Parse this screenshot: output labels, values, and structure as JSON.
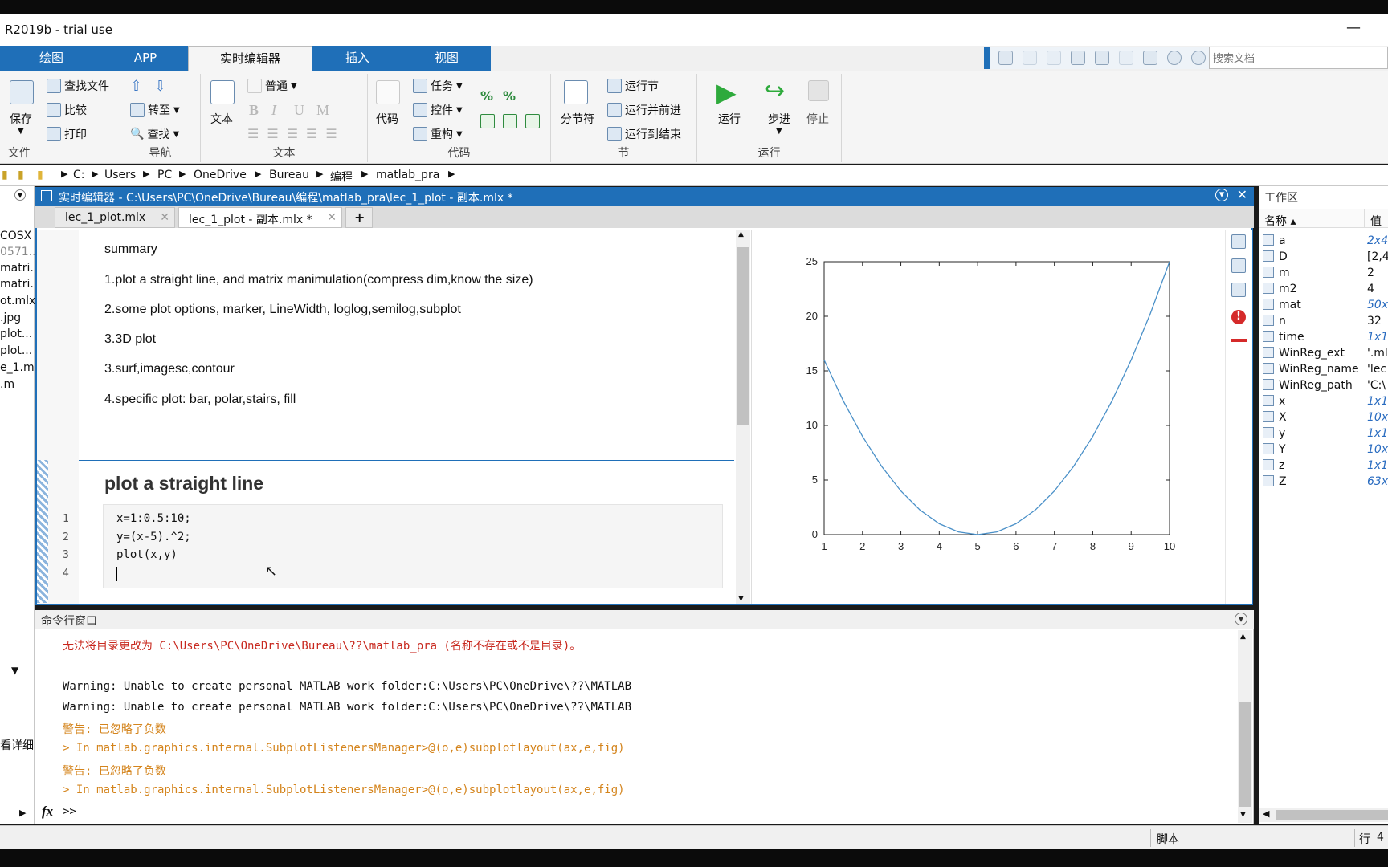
{
  "window": {
    "title": "R2019b - trial use",
    "minimize": "—"
  },
  "ribbon_tabs": [
    "绘图",
    "APP",
    "实时编辑器",
    "插入",
    "视图"
  ],
  "search": {
    "placeholder": "搜索文档"
  },
  "ribbon": {
    "file": {
      "save": "保存",
      "find_files": "查找文件",
      "compare": "比较",
      "print": "打印",
      "label": "文件"
    },
    "navigate": {
      "goto": "转至",
      "find": "查找",
      "label": "导航"
    },
    "text": {
      "text_btn": "文本",
      "style": "普通",
      "bold": "B",
      "italic": "I",
      "underline": "U",
      "mono": "M",
      "label": "文本"
    },
    "code": {
      "code_btn": "代码",
      "task": "任务",
      "control": "控件",
      "refactor": "重构",
      "label": "代码"
    },
    "section": {
      "break": "分节符",
      "run_section": "运行节",
      "run_advance": "运行并前进",
      "run_to_end": "运行到结束",
      "label": "节"
    },
    "run": {
      "run": "运行",
      "step": "步进",
      "stop": "停止",
      "label": "运行"
    }
  },
  "breadcrumb": [
    "C:",
    "Users",
    "PC",
    "OneDrive",
    "Bureau",
    "编程",
    "matlab_pra"
  ],
  "left_files": [
    "COSX",
    "0571...",
    "matri...",
    "matri...",
    "ot.mlx",
    ".jpg",
    "plot...",
    "plot...",
    "e_1.m",
    ".m"
  ],
  "left_detail": "看详细",
  "editor": {
    "header": "实时编辑器 - C:\\Users\\PC\\OneDrive\\Bureau\\编程\\matlab_pra\\lec_1_plot - 副本.mlx *",
    "tabs": [
      "lec_1_plot.mlx",
      "lec_1_plot - 副本.mlx *"
    ],
    "summary": [
      "summary",
      "1.plot a straight line, and matrix manimulation(compress dim,know the size)",
      "2.some plot options, marker, LineWidth, loglog,semilog,subplot",
      "3.3D plot",
      "3.surf,imagesc,contour",
      "4.specific plot: bar, polar,stairs, fill"
    ],
    "section_title": "plot a straight line",
    "code_lines": [
      "x=1:0.5:10;",
      "y=(x-5).^2;",
      "plot(x,y)",
      ""
    ],
    "line_numbers": [
      "1",
      "2",
      "3",
      "4"
    ]
  },
  "chart_data": {
    "type": "line",
    "x": [
      1,
      1.5,
      2,
      2.5,
      3,
      3.5,
      4,
      4.5,
      5,
      5.5,
      6,
      6.5,
      7,
      7.5,
      8,
      8.5,
      9,
      9.5,
      10
    ],
    "y": [
      16,
      12.25,
      9,
      6.25,
      4,
      2.25,
      1,
      0.25,
      0,
      0.25,
      1,
      2.25,
      4,
      6.25,
      9,
      12.25,
      16,
      20.25,
      25
    ],
    "xlim": [
      1,
      10
    ],
    "ylim": [
      0,
      25
    ],
    "xticks": [
      "1",
      "2",
      "3",
      "4",
      "5",
      "6",
      "7",
      "8",
      "9",
      "10"
    ],
    "yticks": [
      "0",
      "5",
      "10",
      "15",
      "20",
      "25"
    ],
    "color": "#4a90c8",
    "title": "",
    "xlabel": "",
    "ylabel": ""
  },
  "command_window": {
    "title": "命令行窗口",
    "lines": [
      {
        "text": "无法将目录更改为 C:\\Users\\PC\\OneDrive\\Bureau\\??\\matlab_pra (名称不存在或不是目录)。",
        "color": "red"
      },
      {
        "text": "",
        "color": "black"
      },
      {
        "text": "Warning: Unable to create personal MATLAB work folder:C:\\Users\\PC\\OneDrive\\??\\MATLAB",
        "color": "black"
      },
      {
        "text": "Warning: Unable to create personal MATLAB work folder:C:\\Users\\PC\\OneDrive\\??\\MATLAB",
        "color": "black"
      },
      {
        "text": "警告: 已忽略了负数",
        "color": "orange"
      },
      {
        "text": "> In matlab.graphics.internal.SubplotListenersManager>@(o,e)subplotlayout(ax,e,fig)",
        "color": "orange"
      },
      {
        "text": "警告: 已忽略了负数",
        "color": "orange"
      },
      {
        "text": "> In matlab.graphics.internal.SubplotListenersManager>@(o,e)subplotlayout(ax,e,fig)",
        "color": "orange"
      }
    ],
    "prompt": ">>",
    "fx": "fx"
  },
  "workspace": {
    "title": "工作区",
    "col_name": "名称 ▴",
    "col_value": "值",
    "vars": [
      {
        "name": "a",
        "value": "2x4"
      },
      {
        "name": "D",
        "value": "[2,4"
      },
      {
        "name": "m",
        "value": "2"
      },
      {
        "name": "m2",
        "value": "4"
      },
      {
        "name": "mat",
        "value": "50x"
      },
      {
        "name": "n",
        "value": "32"
      },
      {
        "name": "time",
        "value": "1x1"
      },
      {
        "name": "WinReg_ext",
        "value": "'.ml"
      },
      {
        "name": "WinReg_name",
        "value": "'lec"
      },
      {
        "name": "WinReg_path",
        "value": "'C:\\"
      },
      {
        "name": "x",
        "value": "1x1"
      },
      {
        "name": "X",
        "value": "10x"
      },
      {
        "name": "y",
        "value": "1x1"
      },
      {
        "name": "Y",
        "value": "10x"
      },
      {
        "name": "z",
        "value": "1x1"
      },
      {
        "name": "Z",
        "value": "63x"
      }
    ]
  },
  "status": {
    "mode": "脚本",
    "row_label": "行",
    "row": "4"
  }
}
